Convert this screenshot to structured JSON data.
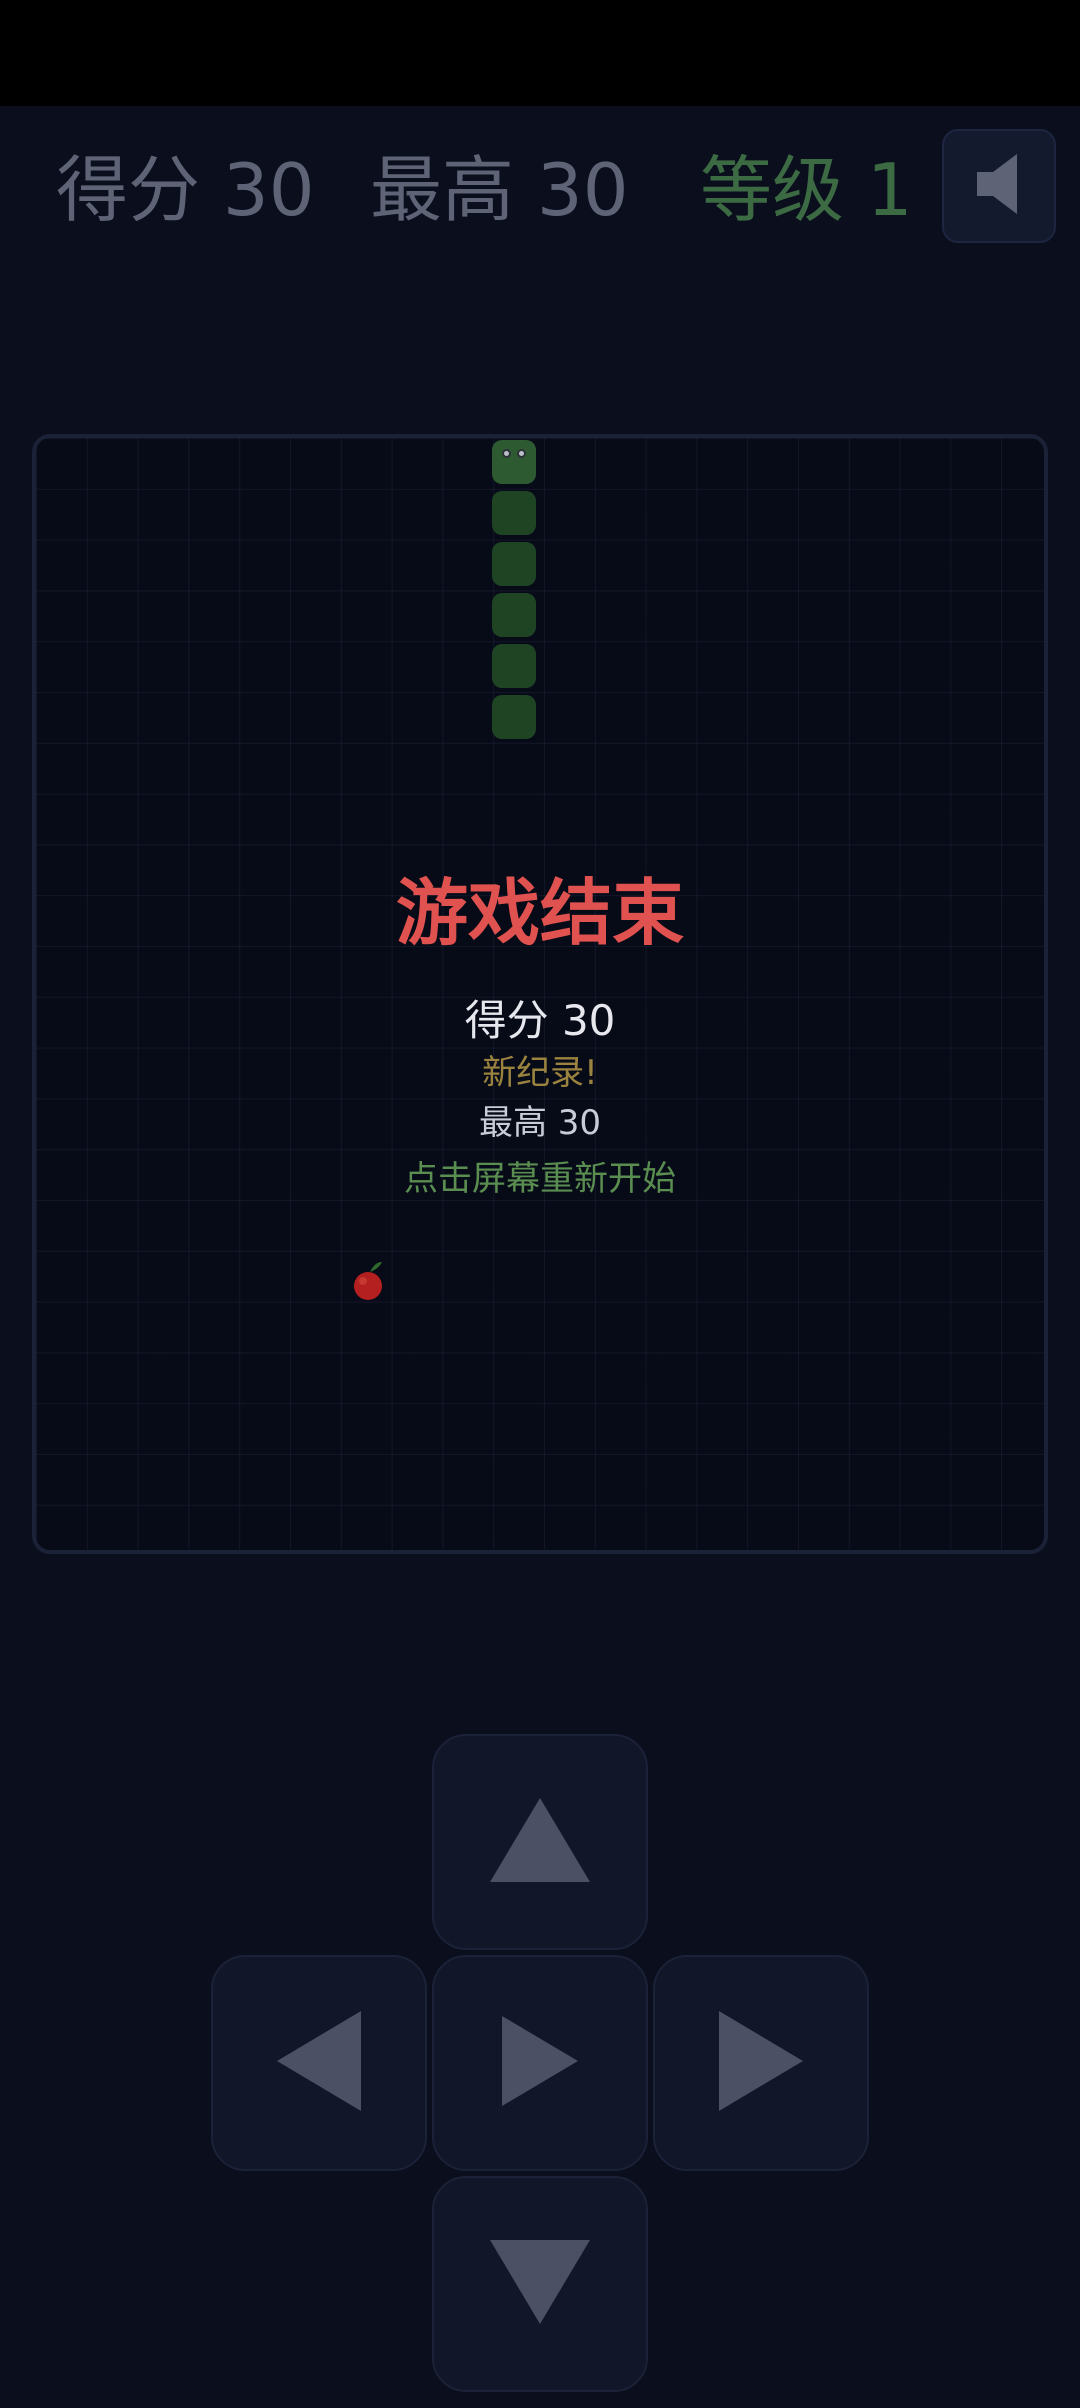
{
  "hud": {
    "score_text": "得分 30",
    "best_text": "最高 30",
    "level_text": "等级 1",
    "sound_icon": "speaker-muted-icon"
  },
  "game_over": {
    "title": "游戏结束",
    "score_text": "得分 30",
    "new_record": "新纪录!",
    "best_text": "最高 30",
    "restart_hint": "点击屏幕重新开始"
  },
  "board": {
    "snake_length": 6,
    "snake_head_color": "#2e5a32",
    "snake_body_color": "#1f4424",
    "food_icon": "apple-icon",
    "food_color": "#b4201f"
  },
  "controls": {
    "up_icon": "arrow-up-icon",
    "left_icon": "arrow-left-icon",
    "center_icon": "play-icon",
    "right_icon": "arrow-right-icon",
    "down_icon": "arrow-down-icon"
  },
  "colors": {
    "background": "#0b0e1d",
    "hud_text": "#5e6476",
    "level_text": "#3c6b43",
    "title_red": "#e0524f",
    "record_gold": "#9a833e",
    "hint_green": "#5a8d50"
  }
}
